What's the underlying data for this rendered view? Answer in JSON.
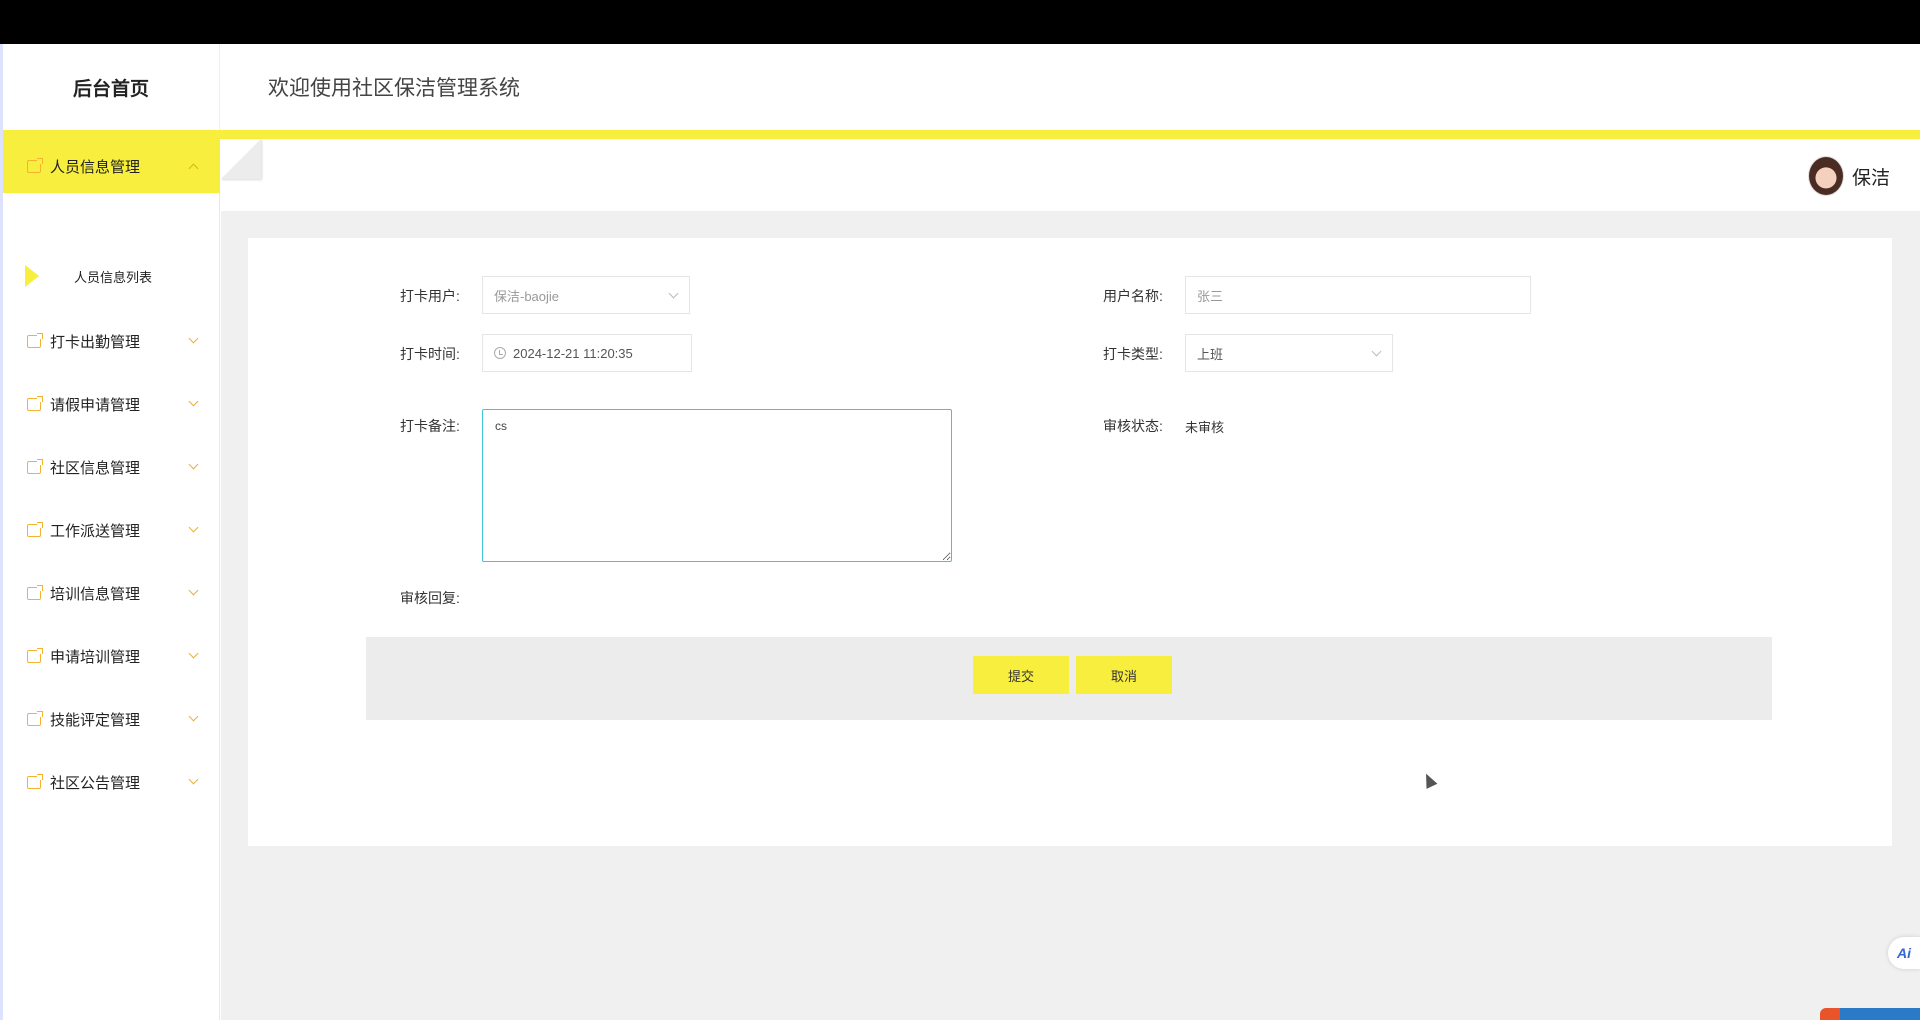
{
  "header": {
    "brand": "后台首页",
    "welcome": "欢迎使用社区保洁管理系统"
  },
  "sidebar": {
    "items": [
      {
        "label": "人员信息管理",
        "icon": "folder-icon",
        "active": true,
        "expanded": true
      },
      {
        "label": "打卡出勤管理",
        "icon": "folder-icon"
      },
      {
        "label": "请假申请管理",
        "icon": "folder-icon"
      },
      {
        "label": "社区信息管理",
        "icon": "folder-icon"
      },
      {
        "label": "工作派送管理",
        "icon": "folder-icon"
      },
      {
        "label": "培训信息管理",
        "icon": "folder-icon"
      },
      {
        "label": "申请培训管理",
        "icon": "folder-icon"
      },
      {
        "label": "技能评定管理",
        "icon": "folder-icon"
      },
      {
        "label": "社区公告管理",
        "icon": "folder-icon"
      }
    ],
    "submenu": {
      "label": "人员信息列表"
    }
  },
  "user": {
    "name": "保洁"
  },
  "form": {
    "checkin_user": {
      "label": "打卡用户:",
      "value": "保洁-baojie"
    },
    "username": {
      "label": "用户名称:",
      "value": "张三"
    },
    "checkin_time": {
      "label": "打卡时间:",
      "value": "2024-12-21 11:20:35"
    },
    "checkin_type": {
      "label": "打卡类型:",
      "value": "上班"
    },
    "remark": {
      "label": "打卡备注:",
      "value": "cs"
    },
    "review_status": {
      "label": "审核状态:",
      "value": "未审核"
    },
    "review_reply": {
      "label": "审核回复:",
      "value": ""
    }
  },
  "buttons": {
    "submit": "提交",
    "cancel": "取消"
  },
  "colors": {
    "accent": "#f7ee3e",
    "icon": "#f2b330",
    "focus_border": "#40c4d8"
  }
}
